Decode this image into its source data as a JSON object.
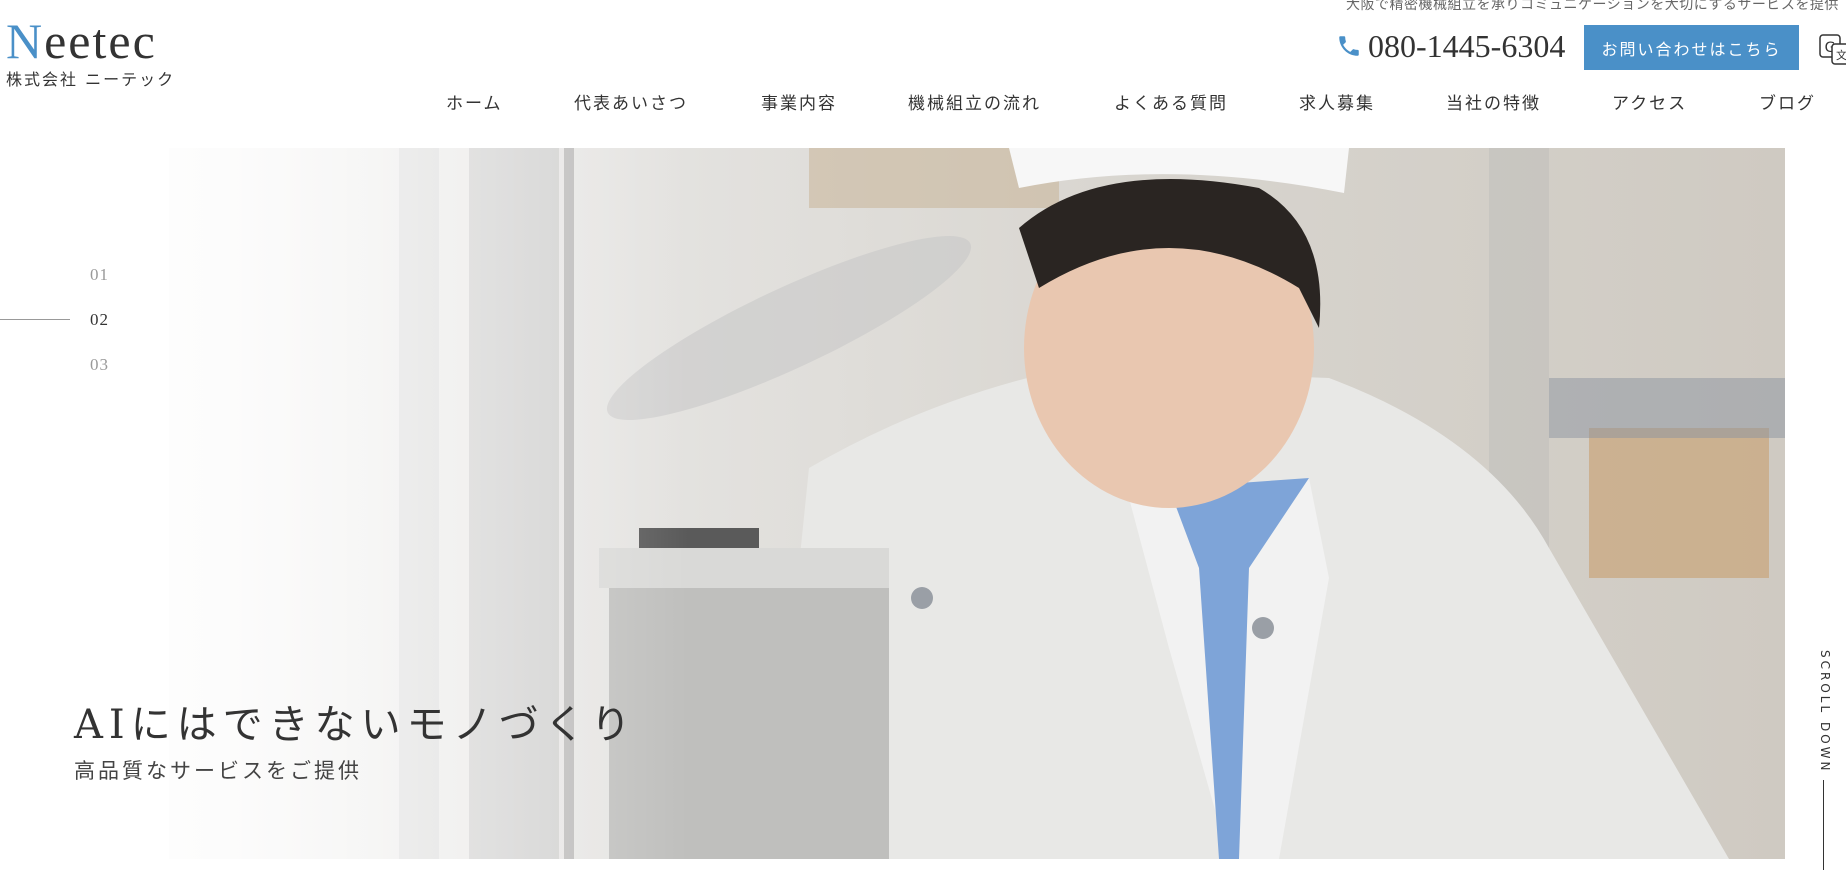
{
  "header": {
    "tagline": "大阪で精密機械組立を承りコミュニケーションを大切にするサービスを提供",
    "logo_main_initial": "N",
    "logo_main_rest": "eetec",
    "logo_sub": "株式会社 ニーテック",
    "phone": "080-1445-6304",
    "contact_label": "お問い合わせはこちら",
    "translate_icon": "google-translate-icon"
  },
  "nav": {
    "items": [
      "ホーム",
      "代表あいさつ",
      "事業内容",
      "機械組立の流れ",
      "よくある質問",
      "求人募集",
      "当社の特徴",
      "アクセス",
      "ブログ"
    ]
  },
  "hero": {
    "slides": [
      "01",
      "02",
      "03"
    ],
    "active_slide": "02",
    "title": "AIにはできないモノづくり",
    "subtitle": "高品質なサービスをご提供",
    "scroll_label": "SCROLL DOWN"
  },
  "colors": {
    "accent": "#4a90c8",
    "text": "#333333"
  }
}
